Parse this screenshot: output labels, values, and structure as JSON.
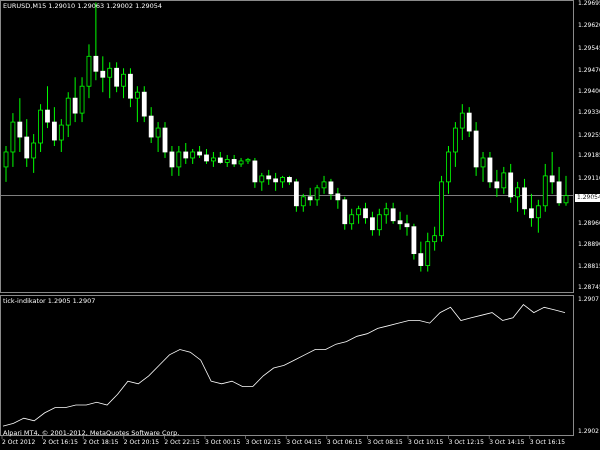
{
  "main_chart": {
    "header": "EURUSD,M15  1.29010 1.29063 1.29002 1.29054",
    "price_ticks": [
      "1.29695",
      "1.29620",
      "1.29545",
      "1.29470",
      "1.29400",
      "1.29330",
      "1.29255",
      "1.29185",
      "1.29110",
      "1.29035",
      "1.28960",
      "1.28890",
      "1.28815",
      "1.28745"
    ],
    "current_price": "1.29054",
    "candle_up_color": "#00ff00",
    "candle_down_color": "#ffffff",
    "bid_line_color": "#a8a8a8"
  },
  "indicator": {
    "header": "tick-indikator 1.2905 1.2907",
    "scale_top": "1.2907",
    "scale_bottom": "1.2902",
    "line_color": "#ffffff"
  },
  "time_axis": {
    "labels": [
      "2 Oct 2012",
      "2 Oct 16:15",
      "2 Oct 18:15",
      "2 Oct 20:15",
      "2 Oct 22:15",
      "3 Oct 00:15",
      "3 Oct 02:15",
      "3 Oct 04:15",
      "3 Oct 06:15",
      "3 Oct 08:15",
      "3 Oct 10:15",
      "3 Oct 12:15",
      "3 Oct 14:15",
      "3 Oct 16:15"
    ]
  },
  "footer": {
    "copyright": "Alpari MT4, © 2001-2012, MetaQuotes Software Corp."
  },
  "chart_data": [
    {
      "type": "candlestick",
      "title": "EURUSD,M15",
      "ylim": [
        1.28745,
        1.29695
      ],
      "candles": [
        [
          1.2915,
          1.2922,
          1.291,
          1.292
        ],
        [
          1.292,
          1.2933,
          1.2915,
          1.293
        ],
        [
          1.293,
          1.2938,
          1.292,
          1.2925
        ],
        [
          1.2925,
          1.2931,
          1.2915,
          1.2918
        ],
        [
          1.2918,
          1.2926,
          1.2913,
          1.2923
        ],
        [
          1.2923,
          1.2936,
          1.292,
          1.2934
        ],
        [
          1.2934,
          1.2942,
          1.2928,
          1.293
        ],
        [
          1.293,
          1.2935,
          1.2922,
          1.2924
        ],
        [
          1.2924,
          1.2931,
          1.292,
          1.2929
        ],
        [
          1.2929,
          1.294,
          1.2925,
          1.2938
        ],
        [
          1.2938,
          1.2945,
          1.293,
          1.2933
        ],
        [
          1.2933,
          1.2945,
          1.293,
          1.2942
        ],
        [
          1.2942,
          1.2956,
          1.2938,
          1.2952
        ],
        [
          1.2952,
          1.297,
          1.2944,
          1.2947
        ],
        [
          1.2947,
          1.2952,
          1.294,
          1.2945
        ],
        [
          1.2945,
          1.295,
          1.2938,
          1.2948
        ],
        [
          1.2948,
          1.295,
          1.294,
          1.2942
        ],
        [
          1.2942,
          1.2948,
          1.2938,
          1.2946
        ],
        [
          1.2946,
          1.2948,
          1.2935,
          1.2938
        ],
        [
          1.2938,
          1.2942,
          1.293,
          1.294
        ],
        [
          1.294,
          1.2942,
          1.293,
          1.2932
        ],
        [
          1.2932,
          1.2935,
          1.2923,
          1.2925
        ],
        [
          1.2925,
          1.293,
          1.292,
          1.2928
        ],
        [
          1.2928,
          1.293,
          1.2918,
          1.292
        ],
        [
          1.292,
          1.2922,
          1.2912,
          1.2915
        ],
        [
          1.2915,
          1.2922,
          1.2912,
          1.292
        ],
        [
          1.292,
          1.2923,
          1.2916,
          1.2918
        ],
        [
          1.2918,
          1.2921,
          1.2916,
          1.292
        ],
        [
          1.292,
          1.2922,
          1.2918,
          1.2919
        ],
        [
          1.2919,
          1.2921,
          1.2916,
          1.2917
        ],
        [
          1.2917,
          1.292,
          1.2915,
          1.2918
        ],
        [
          1.2918,
          1.292,
          1.2916,
          1.29165
        ],
        [
          1.29165,
          1.2919,
          1.2915,
          1.29175
        ],
        [
          1.29175,
          1.2919,
          1.2915,
          1.2916
        ],
        [
          1.2916,
          1.2918,
          1.2915,
          1.2917
        ],
        [
          1.2917,
          1.2918,
          1.2916,
          1.29175
        ],
        [
          1.2917,
          1.2918,
          1.2908,
          1.291
        ],
        [
          1.291,
          1.2913,
          1.2907,
          1.2912
        ],
        [
          1.2912,
          1.2914,
          1.2909,
          1.2911
        ],
        [
          1.2911,
          1.2913,
          1.2907,
          1.291
        ],
        [
          1.291,
          1.2912,
          1.2908,
          1.29115
        ],
        [
          1.29115,
          1.2912,
          1.2909,
          1.291
        ],
        [
          1.291,
          1.2911,
          1.29,
          1.2902
        ],
        [
          1.2902,
          1.2906,
          1.29,
          1.2905
        ],
        [
          1.2905,
          1.2908,
          1.2902,
          1.2904
        ],
        [
          1.2904,
          1.2909,
          1.2902,
          1.2908
        ],
        [
          1.2908,
          1.2912,
          1.2906,
          1.291
        ],
        [
          1.291,
          1.2911,
          1.2904,
          1.2906
        ],
        [
          1.2906,
          1.2908,
          1.2901,
          1.2904
        ],
        [
          1.2904,
          1.2905,
          1.2894,
          1.2896
        ],
        [
          1.2896,
          1.2901,
          1.2894,
          1.2899
        ],
        [
          1.2899,
          1.2902,
          1.2896,
          1.2901
        ],
        [
          1.2901,
          1.2903,
          1.2896,
          1.2898
        ],
        [
          1.2898,
          1.29,
          1.2892,
          1.2894
        ],
        [
          1.2894,
          1.2901,
          1.2892,
          1.2899
        ],
        [
          1.2899,
          1.2903,
          1.2896,
          1.2901
        ],
        [
          1.2901,
          1.2903,
          1.2896,
          1.2897
        ],
        [
          1.2897,
          1.29,
          1.2894,
          1.2896
        ],
        [
          1.2896,
          1.2899,
          1.2892,
          1.2895
        ],
        [
          1.2895,
          1.2896,
          1.2884,
          1.2886
        ],
        [
          1.2886,
          1.289,
          1.288,
          1.2882
        ],
        [
          1.2882,
          1.2893,
          1.288,
          1.289
        ],
        [
          1.289,
          1.2895,
          1.2887,
          1.2892
        ],
        [
          1.2892,
          1.2912,
          1.289,
          1.291
        ],
        [
          1.291,
          1.2922,
          1.2906,
          1.292
        ],
        [
          1.292,
          1.293,
          1.2915,
          1.2928
        ],
        [
          1.2928,
          1.2936,
          1.2924,
          1.2933
        ],
        [
          1.2933,
          1.2935,
          1.2925,
          1.2927
        ],
        [
          1.2927,
          1.293,
          1.2912,
          1.2915
        ],
        [
          1.2915,
          1.292,
          1.291,
          1.2918
        ],
        [
          1.2918,
          1.292,
          1.2908,
          1.291
        ],
        [
          1.291,
          1.2914,
          1.2905,
          1.2908
        ],
        [
          1.2908,
          1.2915,
          1.2906,
          1.2913
        ],
        [
          1.2913,
          1.2916,
          1.2903,
          1.2905
        ],
        [
          1.2905,
          1.291,
          1.29,
          1.2908
        ],
        [
          1.2908,
          1.2911,
          1.2899,
          1.2901
        ],
        [
          1.2901,
          1.2906,
          1.2895,
          1.2898
        ],
        [
          1.2898,
          1.2904,
          1.2893,
          1.2902
        ],
        [
          1.2902,
          1.2916,
          1.29,
          1.2912
        ],
        [
          1.2912,
          1.292,
          1.2906,
          1.291
        ],
        [
          1.291,
          1.2915,
          1.2902,
          1.2903
        ],
        [
          1.2903,
          1.2912,
          1.2902,
          1.29054
        ]
      ]
    },
    {
      "type": "line",
      "title": "tick-indikator",
      "ylim": [
        1.2902,
        1.2907
      ],
      "values": [
        1.29023,
        1.29024,
        1.29026,
        1.29025,
        1.29028,
        1.2903,
        1.2903,
        1.29031,
        1.29031,
        1.29032,
        1.29031,
        1.29035,
        1.2904,
        1.29039,
        1.29042,
        1.29046,
        1.2905,
        1.29052,
        1.29051,
        1.29048,
        1.2904,
        1.29039,
        1.2904,
        1.29038,
        1.29038,
        1.29042,
        1.29045,
        1.29046,
        1.29048,
        1.2905,
        1.29052,
        1.29052,
        1.29054,
        1.29055,
        1.29057,
        1.29058,
        1.2906,
        1.29061,
        1.29062,
        1.29063,
        1.29063,
        1.29062,
        1.29066,
        1.29068,
        1.29063,
        1.29064,
        1.29065,
        1.29066,
        1.29063,
        1.29064,
        1.29069,
        1.29066,
        1.29068,
        1.29067,
        1.29066
      ]
    }
  ]
}
